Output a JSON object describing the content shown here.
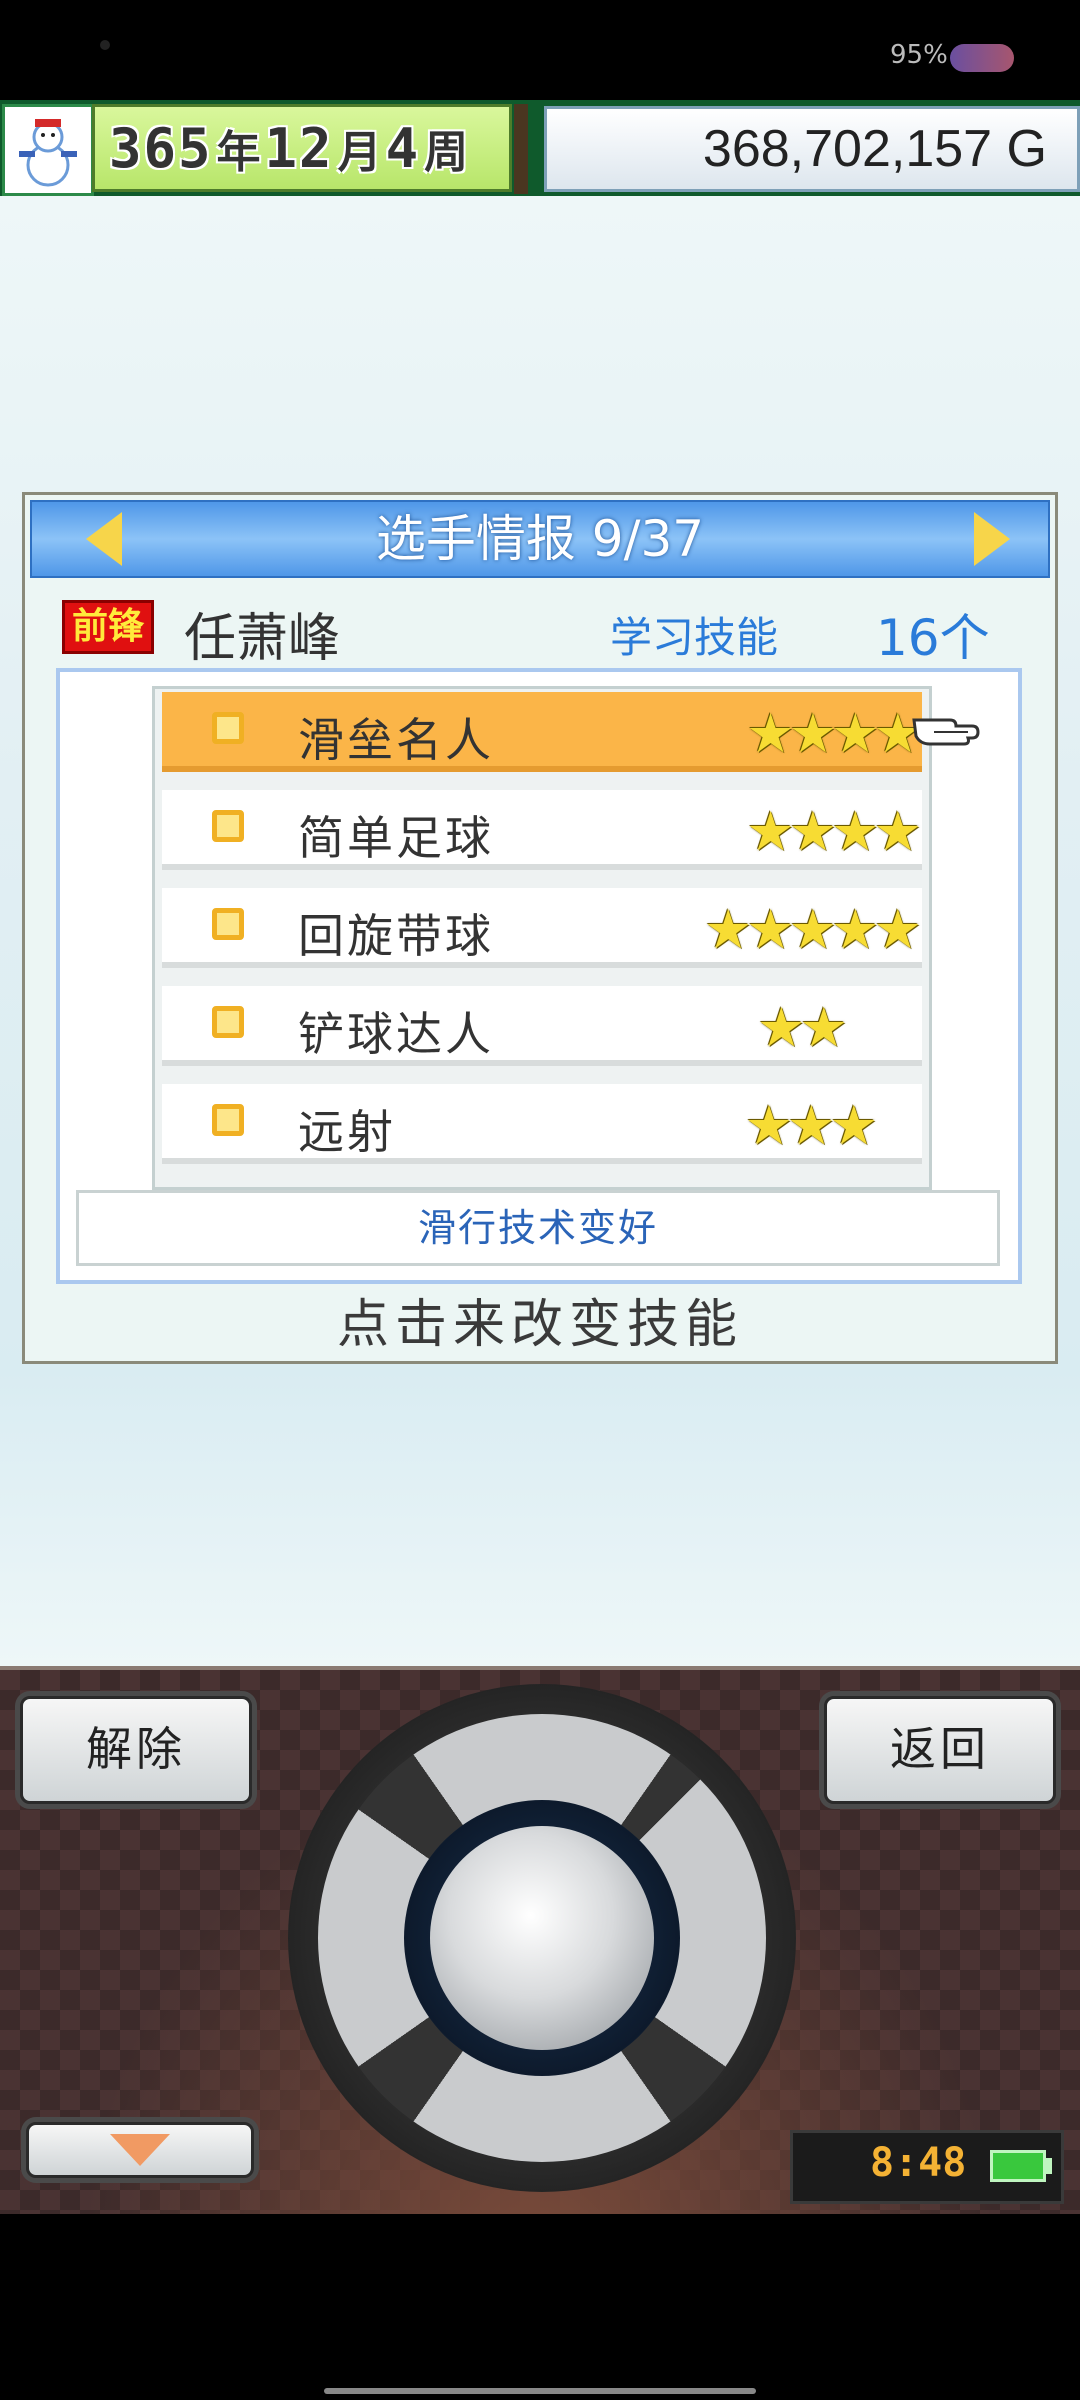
{
  "status_bar": {
    "battery_percent": "95%"
  },
  "header": {
    "year": "365",
    "year_unit": "年",
    "month": "12",
    "month_unit": "月",
    "week": "4",
    "week_unit": "周",
    "money": "368,702,157 G"
  },
  "panel": {
    "title": "选手情报 9/37",
    "position_badge": "前锋",
    "player_name": "任萧峰",
    "learn_label": "学习技能",
    "learn_count": "16个",
    "skills": [
      {
        "name": "滑垒名人",
        "stars": 4,
        "stars_text": "★★★★",
        "selected": true
      },
      {
        "name": "简单足球",
        "stars": 4,
        "stars_text": "★★★★",
        "selected": false
      },
      {
        "name": "回旋带球",
        "stars": 5,
        "stars_text": "★★★★★",
        "selected": false
      },
      {
        "name": "铲球达人",
        "stars": 2,
        "stars_text": "★★",
        "selected": false
      },
      {
        "name": "远射",
        "stars": 3,
        "stars_text": "★★★",
        "selected": false
      }
    ],
    "description": "滑行技术变好",
    "hint": "点击来改变技能"
  },
  "controls": {
    "release_label": "解除",
    "back_label": "返回",
    "clock": "8:48"
  },
  "colors": {
    "title_bar": "#4f97e8",
    "selected_row": "#fbb548",
    "accent_text": "#2a7bd9",
    "badge": "#e01010"
  }
}
